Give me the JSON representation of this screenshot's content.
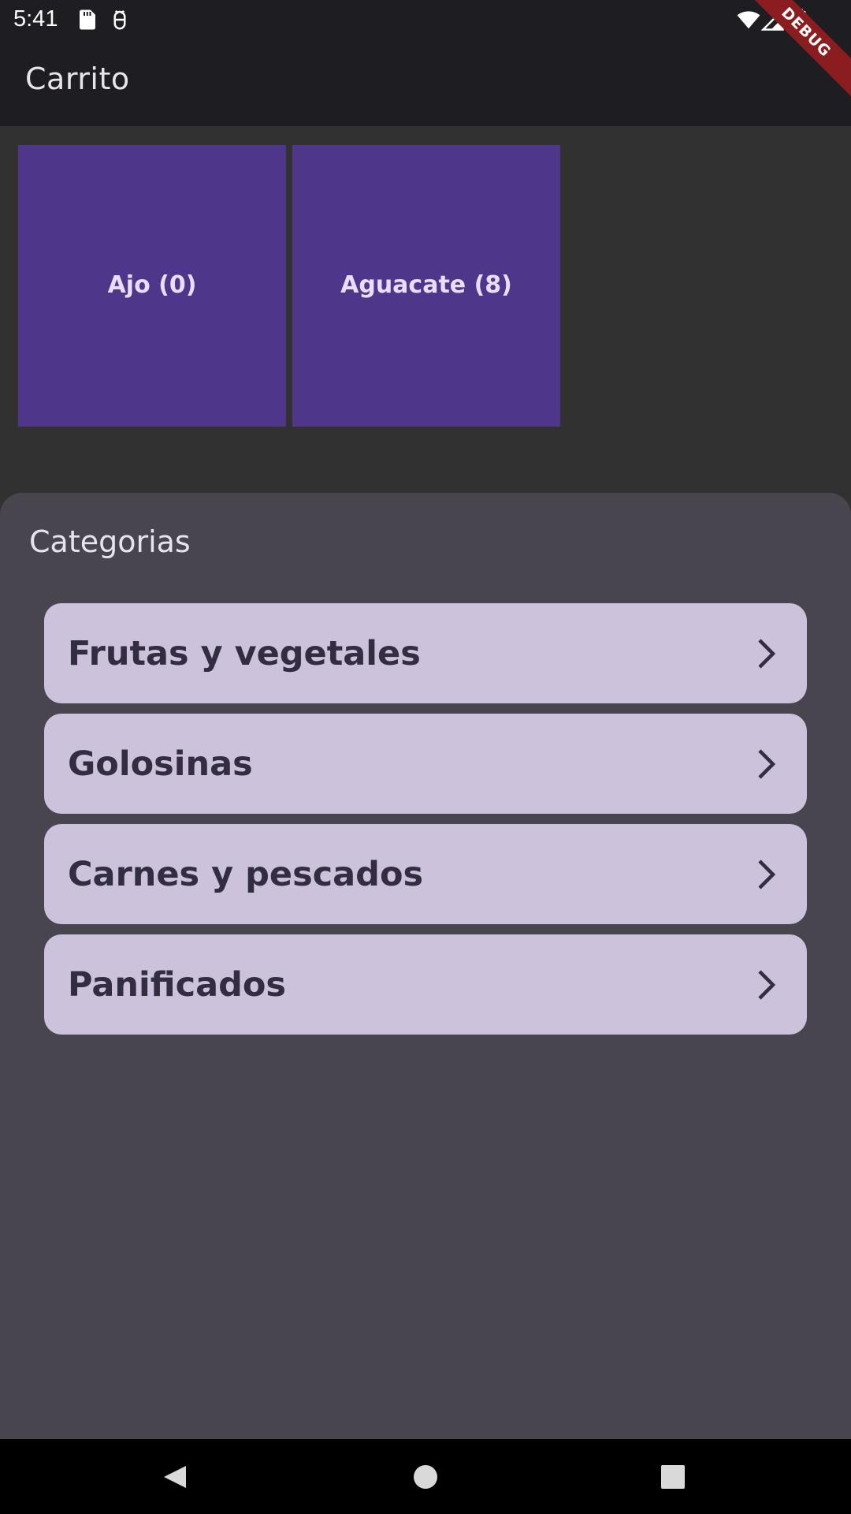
{
  "status_bar": {
    "time": "5:41",
    "icons": [
      "sd-card-icon",
      "usb-debug-icon",
      "wifi-icon",
      "signal-icon",
      "battery-icon"
    ]
  },
  "app_bar": {
    "title": "Carrito"
  },
  "debug_banner": {
    "label": "DEBUG"
  },
  "cart": {
    "items": [
      {
        "label": "Ajo (0)"
      },
      {
        "label": "Aguacate (8)"
      }
    ]
  },
  "categories": {
    "title": "Categorias",
    "items": [
      {
        "label": "Frutas y vegetales"
      },
      {
        "label": "Golosinas"
      },
      {
        "label": "Carnes y pescados"
      },
      {
        "label": "Panificados"
      }
    ]
  },
  "nav_bar": {
    "buttons": [
      "back-icon",
      "home-icon",
      "recents-icon"
    ]
  },
  "colors": {
    "app_bar": "#1e1d22",
    "background": "#313131",
    "tile": "#4e378b",
    "tile_text": "#eaddff",
    "sheet": "#49454f",
    "category_card": "#ccc2dc",
    "category_text": "#332d41",
    "debug_ribbon": "#8b1c20"
  }
}
